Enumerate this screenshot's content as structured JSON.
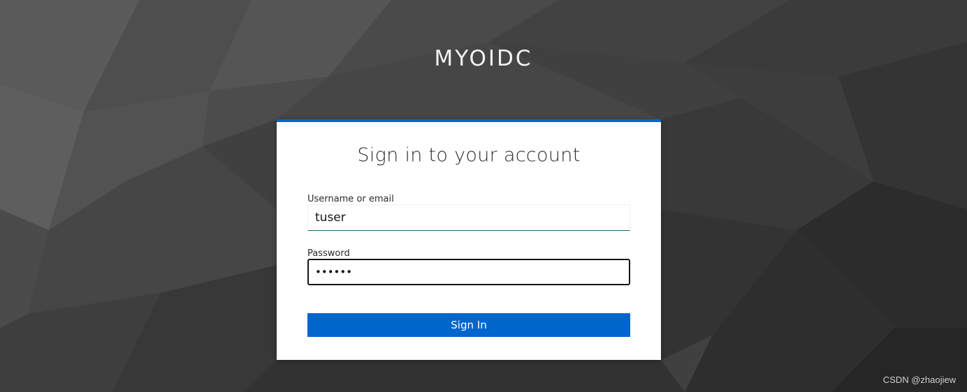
{
  "realm": {
    "title": "MYOIDC"
  },
  "login": {
    "heading": "Sign in to your account",
    "username_label": "Username or email",
    "username_value": "tuser",
    "password_label": "Password",
    "password_value": "123456",
    "signin_label": "Sign In"
  },
  "watermark": "CSDN @zhaojiew",
  "colors": {
    "accent": "#0066cc",
    "background": "#3a3a3a",
    "card": "#ffffff"
  }
}
